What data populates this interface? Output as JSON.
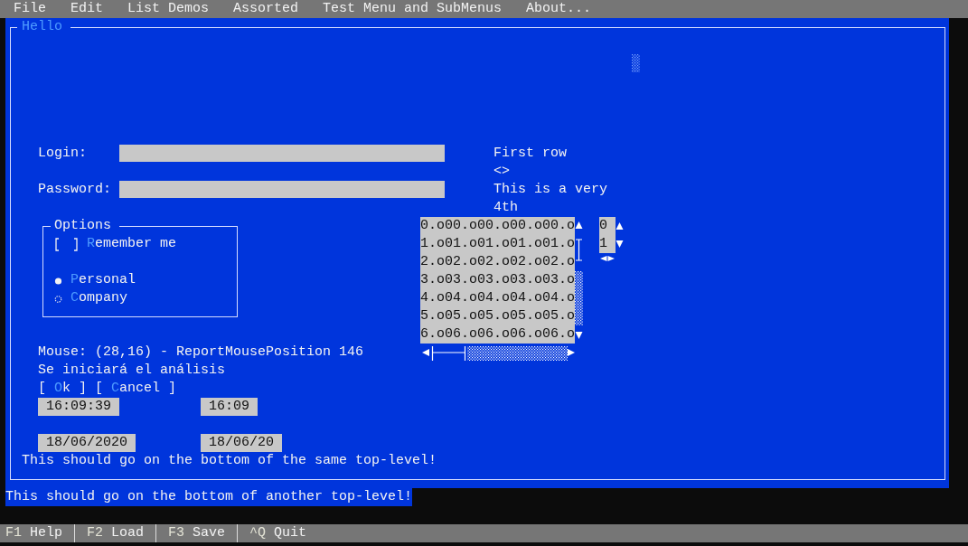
{
  "menu_bar": [
    {
      "label": "File"
    },
    {
      "label": "Edit"
    },
    {
      "label": "List Demos"
    },
    {
      "label": "Assorted"
    },
    {
      "label": "Test Menu and SubMenus"
    },
    {
      "label": "About..."
    }
  ],
  "window": {
    "title": "Hello"
  },
  "login": {
    "label": "Login:"
  },
  "password": {
    "label": "Password:"
  },
  "right_texts": [
    "First row",
    "<>",
    "This is a very",
    "4th"
  ],
  "options": {
    "title": "Options",
    "checkbox": {
      "hotkey": "R",
      "rest": "emember me",
      "checked": false
    },
    "radios": [
      {
        "hotkey": "P",
        "rest": "ersonal",
        "selected": true
      },
      {
        "hotkey": "C",
        "rest": "ompany",
        "selected": false
      }
    ]
  },
  "list": {
    "rows": [
      "0.o00.o00.o00.o00.o",
      "1.o01.o01.o01.o01.o",
      "2.o02.o02.o02.o02.o",
      "3.o03.o03.o03.o03.o",
      "4.o04.o04.o04.o04.o",
      "5.o05.o05.o05.o05.o",
      "6.o06.o06.o06.o06.o"
    ]
  },
  "small_list": {
    "rows": [
      "0",
      "1"
    ]
  },
  "mouse_report": "Mouse: (28,16) - ReportMousePosition 146",
  "message": "Se iniciará el análisis",
  "buttons": [
    {
      "prefix": "[ ",
      "hotkey": "O",
      "suffix": "k ]"
    },
    {
      "prefix": "[ ",
      "hotkey": "C",
      "suffix": "ancel ]"
    }
  ],
  "time_fields": [
    {
      "value": "16:09:39"
    },
    {
      "value": "16:09"
    }
  ],
  "date_fields": [
    {
      "value": "18/06/2020"
    },
    {
      "value": "18/06/20"
    }
  ],
  "inner_bottom_text": "This should go on the bottom of the same top-level!",
  "outer_bottom_text": "This should go on the bottom of another top-level!",
  "status_bar": [
    {
      "key": "F1",
      "label": "Help"
    },
    {
      "key": "F2",
      "label": "Load"
    },
    {
      "key": "F3",
      "label": "Save"
    },
    {
      "key": "^Q",
      "label": "Quit"
    }
  ]
}
